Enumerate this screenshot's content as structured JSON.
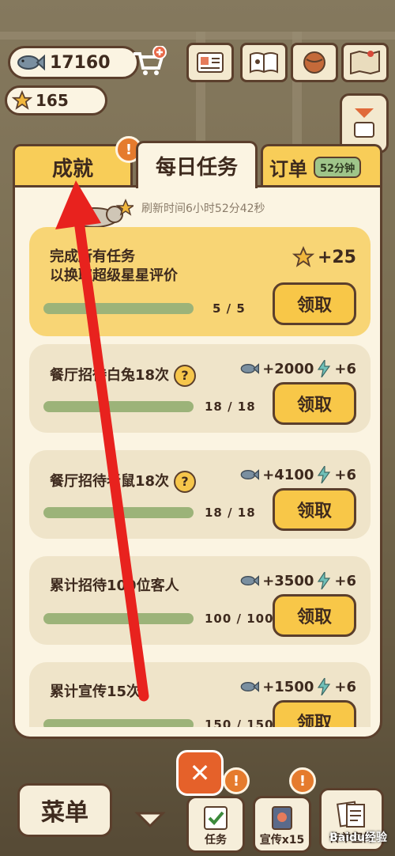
{
  "hud": {
    "coins": "17160",
    "stars": "165"
  },
  "tabs": {
    "achievements": "成就",
    "daily": "每日任务",
    "orders": "订单",
    "order_timer": "52分钟",
    "alert_mark": "!"
  },
  "refresh_text": "刷新时间6小时52分42秒",
  "tasks": [
    {
      "title_line1": "完成所有任务",
      "title_line2": "以换取超级星星评价",
      "reward": "+25",
      "progress": "5  /  5",
      "progress_fraction": 1.0,
      "claim": "领取"
    },
    {
      "title": "餐厅招待白兔18次",
      "reward_fish": "+2000",
      "reward_bolt": "+6",
      "progress": "18  /  18",
      "progress_fraction": 1.0,
      "claim": "领取"
    },
    {
      "title": "餐厅招待老鼠18次",
      "reward_fish": "+4100",
      "reward_bolt": "+6",
      "progress": "18  /  18",
      "progress_fraction": 1.0,
      "claim": "领取"
    },
    {
      "title": "累计招待100位客人",
      "reward_fish": "+3500",
      "reward_bolt": "+6",
      "progress": "100 / 100",
      "progress_fraction": 1.0,
      "claim": "领取"
    },
    {
      "title": "累计宣传15次",
      "reward_fish": "+1500",
      "reward_bolt": "+6",
      "progress": "150 / 150",
      "progress_fraction": 1.0,
      "claim": "领取"
    }
  ],
  "help_mark": "?",
  "close_label": "✕",
  "bottom": {
    "menu": "菜单",
    "task": "任务",
    "promo": "宣传x15",
    "flyer": "传单宣传"
  },
  "watermark": "Baidu经验",
  "colors": {
    "accent_yellow": "#f8c748",
    "panel_bg": "#fbf4e2",
    "progress_green": "#9cb379",
    "arrow_red": "#e8221e",
    "close_orange": "#e5612a"
  }
}
